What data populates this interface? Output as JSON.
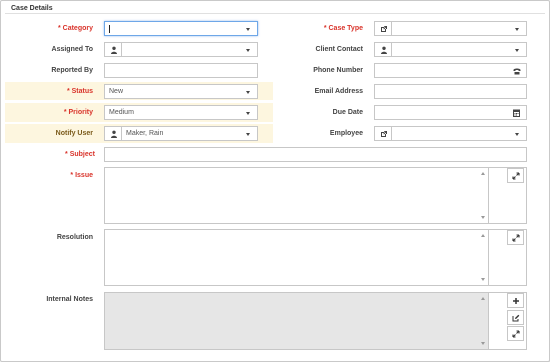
{
  "section": {
    "title": "Case Details"
  },
  "fields": {
    "category": {
      "label": "* Category",
      "value": ""
    },
    "case_type": {
      "label": "* Case Type",
      "value": ""
    },
    "assigned_to": {
      "label": "Assigned To",
      "value": ""
    },
    "client_contact": {
      "label": "Client Contact",
      "value": ""
    },
    "reported_by": {
      "label": "Reported By",
      "value": ""
    },
    "phone_number": {
      "label": "Phone Number",
      "value": ""
    },
    "status": {
      "label": "* Status",
      "value": "New"
    },
    "email_address": {
      "label": "Email Address",
      "value": ""
    },
    "priority": {
      "label": "* Priority",
      "value": "Medium"
    },
    "due_date": {
      "label": "Due Date",
      "value": ""
    },
    "notify_user": {
      "label": "Notify User",
      "value": "Maker, Rain"
    },
    "employee": {
      "label": "Employee",
      "value": ""
    },
    "subject": {
      "label": "* Subject",
      "value": ""
    },
    "issue": {
      "label": "* Issue",
      "value": ""
    },
    "resolution": {
      "label": "Resolution",
      "value": ""
    },
    "internal_notes": {
      "label": "Internal Notes",
      "value": ""
    }
  },
  "icons": {
    "user": "user-icon",
    "link": "link-icon",
    "phone": "phone-icon",
    "calendar": "calendar-icon",
    "expand": "expand-icon",
    "add": "plus-icon",
    "edit": "edit-icon"
  },
  "colors": {
    "required": "#d9342b",
    "highlight": "#fdf6df",
    "focus": "#6ea7e8",
    "readonly": "#e6e6e6"
  }
}
